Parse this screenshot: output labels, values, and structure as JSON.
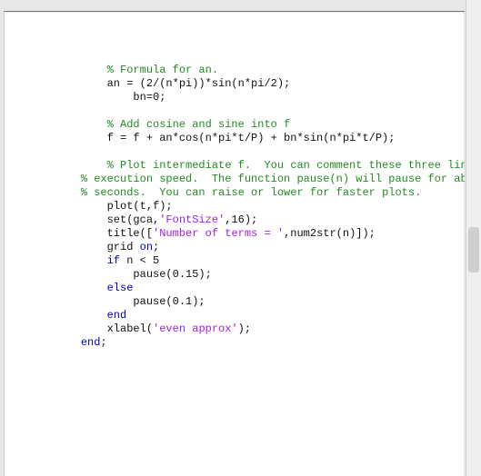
{
  "indent": {
    "i0": "",
    "i1": "    ",
    "i2": "        ",
    "i3": "            "
  },
  "code": {
    "l01": "% Formula for an.",
    "l02": "an = (2/(n*pi))*sin(n*pi/2);",
    "l03": "bn=0;",
    "l04": "% Add cosine and sine into f",
    "l05": "f = f + an*cos(n*pi*t/P) + bn*sin(n*pi*t/P);",
    "l06": "% Plot intermediate f.  You can comment these three lines out for faster",
    "l07": "% execution speed.  The function pause(n) will pause for about n",
    "l08": "% seconds.  You can raise or lower for faster plots.",
    "l09": "plot(t,f);",
    "l10_a": "set(gca,",
    "l10_s": "'FontSize'",
    "l10_b": ",16);",
    "l11_a": "title([",
    "l11_s": "'Number of terms = '",
    "l11_b": ",num2str(n)]);",
    "l12_a": "grid ",
    "l12_k": "on",
    "l12_b": ";",
    "l13_k": "if",
    "l13_b": " n < 5",
    "l14": "pause(0.15);",
    "l15_k": "else",
    "l16": "pause(0.1);",
    "l17_k": "end",
    "l18_a": "xlabel(",
    "l18_s": "'even approx'",
    "l18_b": ");",
    "l19_k": "end",
    "l19_b": ";"
  }
}
